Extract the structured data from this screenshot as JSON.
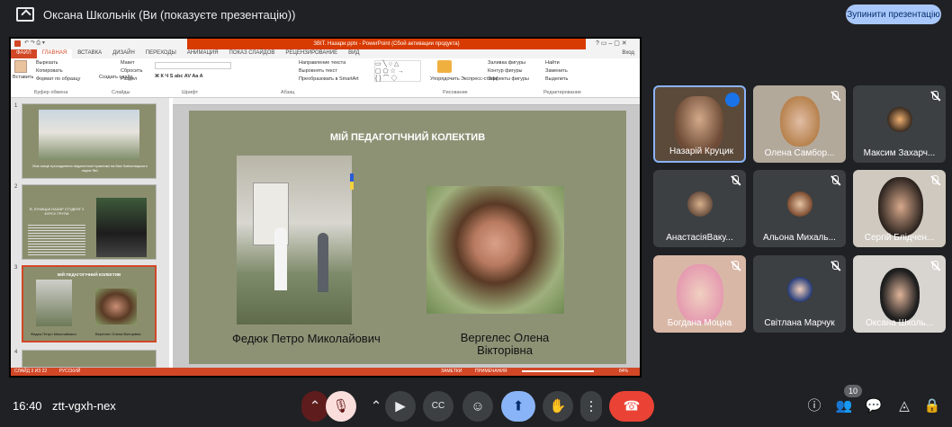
{
  "header": {
    "presenter_title": "Оксана Школьнік (Ви (показуєте презентацію))",
    "stop_button": "Зупинити презентацію"
  },
  "powerpoint": {
    "window_title": "ЗВІТ. Назари.pptx - PowerPoint (Сбой активации продукта)",
    "tabs": [
      "ФАЙЛ",
      "ГЛАВНАЯ",
      "ВСТАВКА",
      "ДИЗАЙН",
      "ПЕРЕХОДЫ",
      "АНИМАЦИЯ",
      "ПОКАЗ СЛАЙДОВ",
      "РЕЦЕНЗИРОВАНИЕ",
      "ВИД"
    ],
    "sign_in": "Вход",
    "ribbon": {
      "paste": "Вставить",
      "cut": "Вырезать",
      "copy": "Копировать",
      "format_painter": "Формат по образцу",
      "clipboard_group": "Буфер обмена",
      "layout": "Макет",
      "reset": "Сбросить",
      "create_slide": "Создать слайд",
      "section": "Раздел",
      "slides_group": "Слайды",
      "font_group": "Шрифт",
      "text_direction": "Направление текста",
      "align_text": "Выровнять текст",
      "smartart": "Преобразовать в SmartArt",
      "paragraph_group": "Абзац",
      "arrange": "Упорядочить",
      "quick_styles": "Экспресс-стили",
      "drawing_group": "Рисование",
      "shape_fill": "Заливка фигуры",
      "shape_outline": "Контур фигуры",
      "shape_effects": "Эффекты фигуры",
      "find": "Найти",
      "replace": "Заменить",
      "select": "Выделить",
      "editing_group": "Редактирование"
    },
    "slide_numbers": [
      "1",
      "2",
      "3",
      "4"
    ],
    "thumb1_text": "Моє місце проходження педагогічної практики на базі Хмільницького ліцею №1",
    "thumb2_title": "Я, ЛУЧИЦЬК НАЗАР СТУДЕНТ 2 КУРСУ ГРУПИ",
    "thumb3_title": "МІЙ ПЕДАГОГІЧНИЙ КОЛЕКТИВ",
    "thumb3_cap1": "Федюк Петро Миколайович",
    "thumb3_cap2": "Вергелес Олена Вікторівна",
    "slide": {
      "title": "МІЙ ПЕДАГОГІЧНИЙ КОЛЕКТИВ",
      "caption_left": "Федюк Петро Миколайович",
      "caption_right": "Вергелес Олена Вікторівна"
    },
    "status": {
      "slide_of": "СЛАЙД 3 ИЗ 22",
      "language": "РУССКИЙ",
      "notes": "ЗАМЕТКИ",
      "comments": "ПРИМЕЧАНИЯ",
      "zoom": "84%"
    }
  },
  "participants": [
    {
      "name": "Назарій Круцик",
      "state": "speaking"
    },
    {
      "name": "Олена Самбор...",
      "state": "muted"
    },
    {
      "name": "Максим Захарч...",
      "state": "muted"
    },
    {
      "name": "АнастасіяВаку...",
      "state": "muted"
    },
    {
      "name": "Альона Михаль...",
      "state": "muted"
    },
    {
      "name": "Сергій Блідчен...",
      "state": "muted"
    },
    {
      "name": "Богдана Моцна",
      "state": "muted"
    },
    {
      "name": "Світлана Марчук",
      "state": "muted"
    },
    {
      "name": "Оксана Школь...",
      "state": "muted"
    }
  ],
  "bottom": {
    "time": "16:40",
    "meeting_code": "ztt-vgxh-nex",
    "people_count": "10"
  }
}
